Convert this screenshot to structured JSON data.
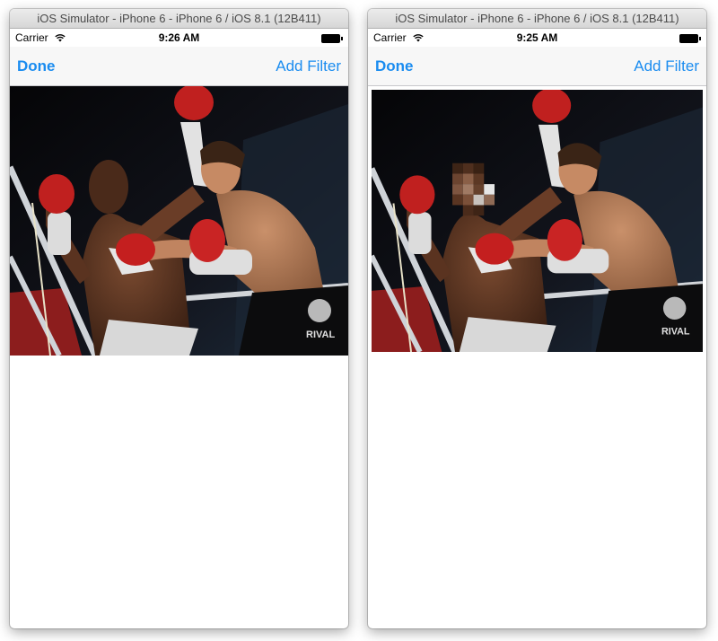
{
  "windows": [
    {
      "title": "iOS Simulator - iPhone 6 - iPhone 6 / iOS 8.1 (12B411)",
      "status": {
        "carrier": "Carrier",
        "time": "9:26 AM"
      },
      "nav": {
        "done_label": "Done",
        "filter_label": "Add Filter"
      },
      "photo": {
        "face_pixelated": false
      }
    },
    {
      "title": "iOS Simulator - iPhone 6 - iPhone 6 / iOS 8.1 (12B411)",
      "status": {
        "carrier": "Carrier",
        "time": "9:25 AM"
      },
      "nav": {
        "done_label": "Done",
        "filter_label": "Add Filter"
      },
      "photo": {
        "face_pixelated": true
      }
    }
  ],
  "colors": {
    "nav_tint": "#1a8cf0",
    "nav_background": "#f7f7f7"
  },
  "icons": [
    "wifi-icon",
    "battery-icon"
  ]
}
